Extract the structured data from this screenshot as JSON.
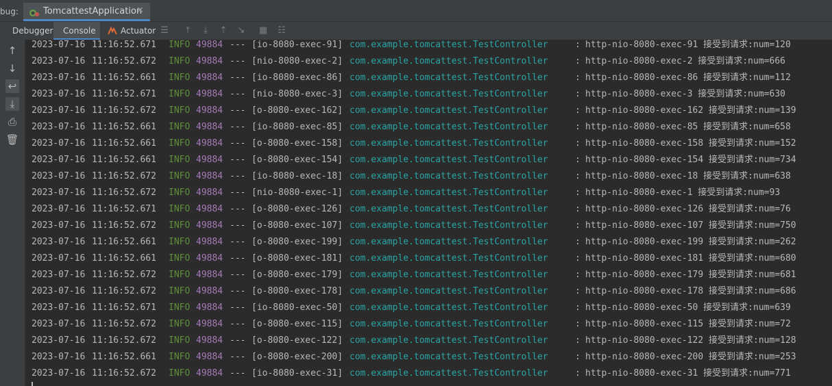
{
  "header": {
    "debug_label": "bug:",
    "run_tab_title": "TomcattestApplication",
    "close_glyph": "✕"
  },
  "toolbar": {
    "tabs": [
      "Debugger",
      "Console",
      "Actuator"
    ],
    "active_tab": "Console",
    "icons": [
      "layout-icon",
      "show-execution-point-icon",
      "step-over-icon",
      "step-into-icon",
      "step-out-icon",
      "run-to-cursor-icon",
      "evaluate-icon",
      "trace-icon"
    ]
  },
  "sidebar": {
    "icons": [
      "up-arrow-icon",
      "down-arrow-icon",
      "soft-wrap-icon",
      "scroll-to-end-icon",
      "print-icon",
      "trash-icon"
    ]
  },
  "colors": {
    "background": "#2b2b2b",
    "info": "#5f8f3a",
    "pid": "#a67ab8",
    "logger": "#2aa5a5",
    "text": "#b9b9b9",
    "accent": "#4a88c7"
  },
  "console": {
    "lines": [
      {
        "date": "2023-07-16",
        "time": "11:16:52.671",
        "level": "INFO",
        "pid": "49884",
        "sep": "---",
        "thread": "[io-8080-exec-91]",
        "logger": "com.example.tomcattest.TestController",
        "colon": ":",
        "message": "http-nio-8080-exec-91 接受到请求:num=120"
      },
      {
        "date": "2023-07-16",
        "time": "11:16:52.672",
        "level": "INFO",
        "pid": "49884",
        "sep": "---",
        "thread": "[nio-8080-exec-2]",
        "logger": "com.example.tomcattest.TestController",
        "colon": ":",
        "message": "http-nio-8080-exec-2 接受到请求:num=666"
      },
      {
        "date": "2023-07-16",
        "time": "11:16:52.661",
        "level": "INFO",
        "pid": "49884",
        "sep": "---",
        "thread": "[io-8080-exec-86]",
        "logger": "com.example.tomcattest.TestController",
        "colon": ":",
        "message": "http-nio-8080-exec-86 接受到请求:num=112"
      },
      {
        "date": "2023-07-16",
        "time": "11:16:52.671",
        "level": "INFO",
        "pid": "49884",
        "sep": "---",
        "thread": "[nio-8080-exec-3]",
        "logger": "com.example.tomcattest.TestController",
        "colon": ":",
        "message": "http-nio-8080-exec-3 接受到请求:num=630"
      },
      {
        "date": "2023-07-16",
        "time": "11:16:52.672",
        "level": "INFO",
        "pid": "49884",
        "sep": "---",
        "thread": "[o-8080-exec-162]",
        "logger": "com.example.tomcattest.TestController",
        "colon": ":",
        "message": "http-nio-8080-exec-162 接受到请求:num=139"
      },
      {
        "date": "2023-07-16",
        "time": "11:16:52.661",
        "level": "INFO",
        "pid": "49884",
        "sep": "---",
        "thread": "[io-8080-exec-85]",
        "logger": "com.example.tomcattest.TestController",
        "colon": ":",
        "message": "http-nio-8080-exec-85 接受到请求:num=658"
      },
      {
        "date": "2023-07-16",
        "time": "11:16:52.661",
        "level": "INFO",
        "pid": "49884",
        "sep": "---",
        "thread": "[o-8080-exec-158]",
        "logger": "com.example.tomcattest.TestController",
        "colon": ":",
        "message": "http-nio-8080-exec-158 接受到请求:num=152"
      },
      {
        "date": "2023-07-16",
        "time": "11:16:52.661",
        "level": "INFO",
        "pid": "49884",
        "sep": "---",
        "thread": "[o-8080-exec-154]",
        "logger": "com.example.tomcattest.TestController",
        "colon": ":",
        "message": "http-nio-8080-exec-154 接受到请求:num=734"
      },
      {
        "date": "2023-07-16",
        "time": "11:16:52.672",
        "level": "INFO",
        "pid": "49884",
        "sep": "---",
        "thread": "[io-8080-exec-18]",
        "logger": "com.example.tomcattest.TestController",
        "colon": ":",
        "message": "http-nio-8080-exec-18 接受到请求:num=638"
      },
      {
        "date": "2023-07-16",
        "time": "11:16:52.672",
        "level": "INFO",
        "pid": "49884",
        "sep": "---",
        "thread": "[nio-8080-exec-1]",
        "logger": "com.example.tomcattest.TestController",
        "colon": ":",
        "message": "http-nio-8080-exec-1 接受到请求:num=93"
      },
      {
        "date": "2023-07-16",
        "time": "11:16:52.671",
        "level": "INFO",
        "pid": "49884",
        "sep": "---",
        "thread": "[o-8080-exec-126]",
        "logger": "com.example.tomcattest.TestController",
        "colon": ":",
        "message": "http-nio-8080-exec-126 接受到请求:num=76"
      },
      {
        "date": "2023-07-16",
        "time": "11:16:52.672",
        "level": "INFO",
        "pid": "49884",
        "sep": "---",
        "thread": "[o-8080-exec-107]",
        "logger": "com.example.tomcattest.TestController",
        "colon": ":",
        "message": "http-nio-8080-exec-107 接受到请求:num=750"
      },
      {
        "date": "2023-07-16",
        "time": "11:16:52.661",
        "level": "INFO",
        "pid": "49884",
        "sep": "---",
        "thread": "[o-8080-exec-199]",
        "logger": "com.example.tomcattest.TestController",
        "colon": ":",
        "message": "http-nio-8080-exec-199 接受到请求:num=262"
      },
      {
        "date": "2023-07-16",
        "time": "11:16:52.661",
        "level": "INFO",
        "pid": "49884",
        "sep": "---",
        "thread": "[o-8080-exec-181]",
        "logger": "com.example.tomcattest.TestController",
        "colon": ":",
        "message": "http-nio-8080-exec-181 接受到请求:num=680"
      },
      {
        "date": "2023-07-16",
        "time": "11:16:52.672",
        "level": "INFO",
        "pid": "49884",
        "sep": "---",
        "thread": "[o-8080-exec-179]",
        "logger": "com.example.tomcattest.TestController",
        "colon": ":",
        "message": "http-nio-8080-exec-179 接受到请求:num=681"
      },
      {
        "date": "2023-07-16",
        "time": "11:16:52.672",
        "level": "INFO",
        "pid": "49884",
        "sep": "---",
        "thread": "[o-8080-exec-178]",
        "logger": "com.example.tomcattest.TestController",
        "colon": ":",
        "message": "http-nio-8080-exec-178 接受到请求:num=686"
      },
      {
        "date": "2023-07-16",
        "time": "11:16:52.671",
        "level": "INFO",
        "pid": "49884",
        "sep": "---",
        "thread": "[io-8080-exec-50]",
        "logger": "com.example.tomcattest.TestController",
        "colon": ":",
        "message": "http-nio-8080-exec-50 接受到请求:num=639"
      },
      {
        "date": "2023-07-16",
        "time": "11:16:52.672",
        "level": "INFO",
        "pid": "49884",
        "sep": "---",
        "thread": "[o-8080-exec-115]",
        "logger": "com.example.tomcattest.TestController",
        "colon": ":",
        "message": "http-nio-8080-exec-115 接受到请求:num=72"
      },
      {
        "date": "2023-07-16",
        "time": "11:16:52.672",
        "level": "INFO",
        "pid": "49884",
        "sep": "---",
        "thread": "[o-8080-exec-122]",
        "logger": "com.example.tomcattest.TestController",
        "colon": ":",
        "message": "http-nio-8080-exec-122 接受到请求:num=128"
      },
      {
        "date": "2023-07-16",
        "time": "11:16:52.661",
        "level": "INFO",
        "pid": "49884",
        "sep": "---",
        "thread": "[o-8080-exec-200]",
        "logger": "com.example.tomcattest.TestController",
        "colon": ":",
        "message": "http-nio-8080-exec-200 接受到请求:num=253"
      },
      {
        "date": "2023-07-16",
        "time": "11:16:52.672",
        "level": "INFO",
        "pid": "49884",
        "sep": "---",
        "thread": "[io-8080-exec-31]",
        "logger": "com.example.tomcattest.TestController",
        "colon": ":",
        "message": "http-nio-8080-exec-31 接受到请求:num=771"
      }
    ]
  }
}
